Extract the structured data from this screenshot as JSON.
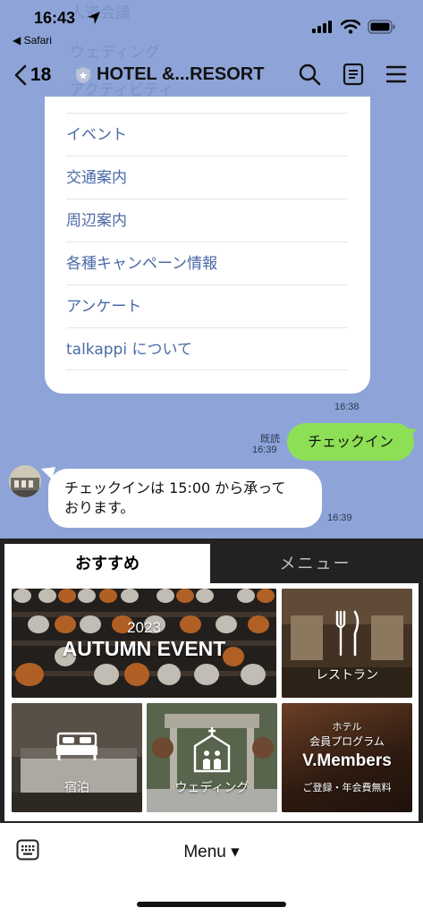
{
  "status_bar": {
    "time": "16:43",
    "back_app": "◀ Safari"
  },
  "nav": {
    "unread_count": "18",
    "title": "HOTEL &...RESORT"
  },
  "background_text": [
    "人道会議",
    "ウェディング",
    "アクティビティ"
  ],
  "menu_list": [
    "イベント",
    "交通案内",
    "周辺案内",
    "各種キャンペーン情報",
    "アンケート",
    "talkappi について"
  ],
  "messages": {
    "menu_time": "16:38",
    "sent": {
      "text": "チェックイン",
      "read_label": "既読",
      "time": "16:39"
    },
    "received": {
      "text_line1": "チェックインは 15:00 から承って",
      "text_line2": "おります。",
      "time": "16:39"
    }
  },
  "rich_menu": {
    "tabs": [
      "おすすめ",
      "メニュー"
    ],
    "active_tab": "おすすめ",
    "tiles": {
      "autumn": {
        "year": "2023",
        "title": "AUTUMN EVENT"
      },
      "restaurant": {
        "label": "レストラン"
      },
      "stay": {
        "label": "宿泊"
      },
      "wedding": {
        "label": "ウェディング"
      },
      "members": {
        "line1": "ホテル",
        "line2": "会員プログラム",
        "title": "V.Members",
        "subtitle": "ご登録・年会費無料"
      }
    }
  },
  "bottom_bar": {
    "menu_label": "Menu ▾"
  },
  "colors": {
    "chat_bg": "#8ea4d8",
    "sent_bubble": "#8de055",
    "menu_link": "#4a6aa6",
    "rich_menu_bg": "#222222"
  }
}
